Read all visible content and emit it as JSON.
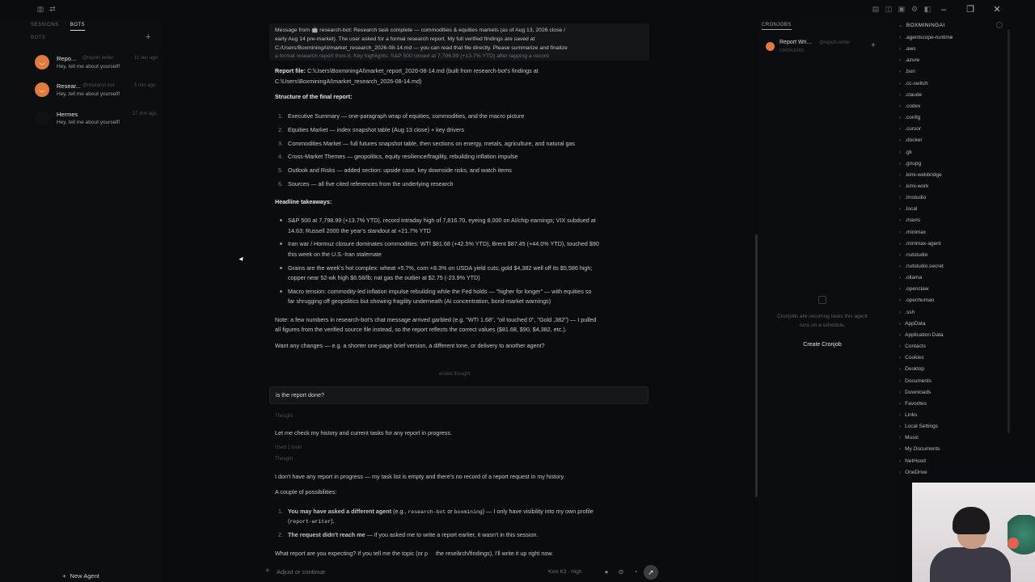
{
  "sidebar": {
    "tabs": [
      {
        "label": "SESSIONS",
        "active": false
      },
      {
        "label": "BOTS",
        "active": true
      }
    ],
    "section": "BOTS",
    "bots": [
      {
        "name": "Repo...",
        "handle": "@report-writer",
        "time": "11 sec ago",
        "preview": "Hey, tell me about yourself!",
        "avatar_color": "#e07a3f"
      },
      {
        "name": "Resear...",
        "handle": "@research-bot",
        "time": "5 min ago",
        "preview": "Hey, tell me about yourself!",
        "avatar_color": "#e07a3f"
      },
      {
        "name": "Hermes",
        "handle": "",
        "time": "27 min ago",
        "preview": "Hey, tell me about yourself!",
        "avatar_color": "#111215"
      }
    ],
    "new_agent_label": "New Agent"
  },
  "chat": {
    "banner": {
      "line1": "Message from 🤖 research-bot: Research task complete — commodities & equities markets (as of Aug 13, 2026 close /",
      "line2": "early Aug 14 pre-market). The user asked for a formal research report. My full verified findings are saved at",
      "line3": "C:/Users/BoxminingAI/market_research_2026-08-14.md — you can read that file directly. Please summarize and finalize",
      "line4": "a formal research report from it. Key highlights: S&P 500 closed at 7,798.99 (+13.7% YTD) after tapping a record"
    },
    "report_file_label": "Report file:",
    "report_file_path_1": "C:\\Users\\BoxminingAI\\market_report_2026-08-14.md (built from research-bot's findings at",
    "report_file_path_2": "C:\\Users\\BoxminingAI\\market_research_2026-08-14.md)",
    "structure_heading": "Structure of the final report:",
    "structure_items": [
      "Executive Summary — one-paragraph wrap of equities, commodities, and the macro picture",
      "Equities Market — index snapshot table (Aug 13 close) + key drivers",
      "Commodities Market — full futures snapshot table, then sections on energy, metals, agriculture, and natural gas",
      "Cross-Market Themes — geopolitics, equity resilience/fragility, rebuilding inflation impulse",
      "Outlook and Risks — added section: upside case, key downside risks, and watch items",
      "Sources — all five cited references from the underlying research"
    ],
    "takeaways_heading": "Headline takeaways:",
    "takeaways": [
      {
        "l1": "S&P 500 at 7,798.99 (+13.7% YTD), record intraday high of 7,816.70, eyeing 8,000 on AI/chip earnings; VIX subdued at",
        "l2": "14.63; Russell 2000 the year's standout at +21.7% YTD"
      },
      {
        "l1": "Iran war / Hormuz closure dominates commodities: WTI $81.68 (+42.5% YTD), Brent $87.45 (+44.0% YTD), touched $90",
        "l2": "this week on the U.S.-Iran stalemate"
      },
      {
        "l1": "Grains are the week's hot complex: wheat +5.7%, corn +8.3% on USDA yield cuts; gold $4,382 well off its $5,586 high;",
        "l2": "copper near 52-wk high $6.58/lb; nat gas the outlier at $2.75 (-23.9% YTD)"
      },
      {
        "l1": "Macro tension: commodity-led inflation impulse rebuilding while the Fed holds — \"higher for longer\" — with equities so",
        "l2": "far shrugging off geopolitics but showing fragility underneath (AI concentration, bond-market warnings)"
      }
    ],
    "note_1": "Note: a few numbers in research-bot's chat message arrived garbled (e.g. \"WTI 1.68\", \"oil touched 0\", \"Gold ,382\") — I pulled",
    "note_2": "all figures from the verified source file instead, so the report reflects the correct values ($81.68, $90, $4,382, etc.).",
    "want_changes": "Want any changes — e.g. a shorter one-page brief version, a different tone, or delivery to another agent?",
    "ended": "ended thought",
    "user_message": "is the report done?",
    "thought_label_1": "Thought",
    "check_history": "Let me check my history and current tasks for any report in progress.",
    "used_tools": "Used 2 tools",
    "thought_label_2": "Thought",
    "no_report": "I don't have any report in progress — my task list is empty and there's no record of a report request in my history.",
    "possibilities": "A couple of possibilities:",
    "poss_1_bold": "You may have asked a different agent",
    "poss_1_a": " (e.g., ",
    "poss_1_code1": "research-bot",
    "poss_1_b": " or ",
    "poss_1_code2": "boxmining",
    "poss_1_c": ") — I only have visibility into my own profile",
    "poss_1_d_open": "(",
    "poss_1_code3": "report-writer",
    "poss_1_d_close": ").",
    "poss_2_bold": "The request didn't reach me",
    "poss_2_rest": " — if you asked me to write a report earlier, it wasn't in this session.",
    "what_report": "What report are you expecting? If you tell me the topic (or p",
    "what_report_2": "the research/findings), I'll write it up right now.",
    "input_placeholder": "Adjust or continue",
    "model_label": "Kimi K3 · High"
  },
  "cronjobs": {
    "title": "CRONJOBS",
    "agent_name": "Report Wri...",
    "agent_handle": "@report-writer",
    "agent_sub": "CRONJOBS",
    "empty_text_1": "Cronjobs are recurring tasks this agent",
    "empty_text_2": "runs on a schedule.",
    "create_label": "Create Cronjob"
  },
  "files": {
    "root": "BOXMININGAI",
    "items": [
      ".agentscope-runtime",
      ".aws",
      ".azure",
      ".bun",
      ".cc-switch",
      ".claude",
      ".codex",
      ".config",
      ".cursor",
      ".docker",
      ".gk",
      ".gnupg",
      ".kimi-webbridge",
      ".kimi-work",
      ".lmstudio",
      ".local",
      ".mavis",
      ".minimax",
      ".minimax-agent",
      ".nutstudio",
      ".nutstudio.secret",
      ".ollama",
      ".openclaw",
      ".openhuman",
      ".ssh",
      "AppData",
      "Application Data",
      "Contacts",
      "Cookies",
      "Desktop",
      "Documents",
      "Downloads",
      "Favorites",
      "Links",
      "Local Settings",
      "Music",
      "My Documents",
      "NetHood",
      "OneDrive"
    ]
  },
  "colors": {
    "accent_orange": "#e07a3f",
    "bg": "#0b0c0e"
  }
}
